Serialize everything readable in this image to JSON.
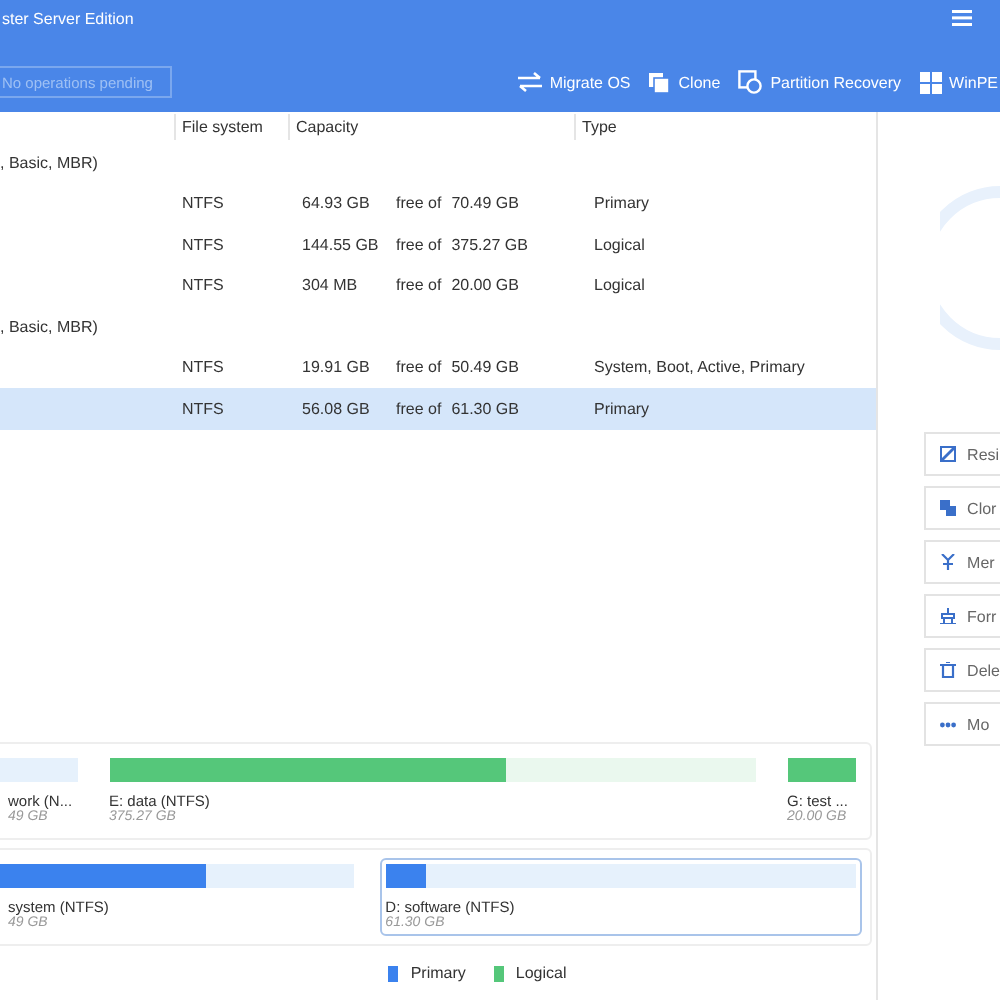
{
  "window": {
    "title": "ster Server Edition"
  },
  "toolbar": {
    "pending": "No operations pending",
    "buttons": [
      {
        "kind": "migrate",
        "label": "Migrate OS"
      },
      {
        "kind": "clone",
        "label": "Clone"
      },
      {
        "kind": "recovery",
        "label": "Partition Recovery"
      },
      {
        "kind": "winpe",
        "label": "WinPE"
      }
    ]
  },
  "table": {
    "columns": [
      "File system",
      "Capacity",
      "Type"
    ],
    "disks": [
      {
        "label": ", Basic, MBR)",
        "rows": [
          {
            "fs": "NTFS",
            "free": "64.93 GB",
            "of": "free of",
            "total": "70.49 GB",
            "type": "Primary",
            "selected": false
          },
          {
            "fs": "NTFS",
            "free": "144.55 GB",
            "of": "free of",
            "total": "375.27 GB",
            "type": "Logical",
            "selected": false
          },
          {
            "fs": "NTFS",
            "free": "304 MB",
            "of": "free of",
            "total": "20.00 GB",
            "type": "Logical",
            "selected": false
          }
        ]
      },
      {
        "label": ", Basic, MBR)",
        "rows": [
          {
            "fs": "NTFS",
            "free": "19.91 GB",
            "of": "free of",
            "total": "50.49 GB",
            "type": "System, Boot, Active, Primary",
            "selected": false
          },
          {
            "fs": "NTFS",
            "free": "56.08 GB",
            "of": "free of",
            "total": "61.30 GB",
            "type": "Primary",
            "selected": true
          }
        ]
      }
    ]
  },
  "actions": [
    {
      "kind": "resize",
      "label": "Resi"
    },
    {
      "kind": "clone",
      "label": "Clor"
    },
    {
      "kind": "merge",
      "label": "Mer"
    },
    {
      "kind": "format",
      "label": "Forr"
    },
    {
      "kind": "delete",
      "label": "Dele"
    },
    {
      "kind": "more",
      "label": "Mo"
    }
  ],
  "disk_map": [
    {
      "selected": false,
      "partitions": [
        {
          "name": "work (N...",
          "size": "49 GB",
          "kind": "primary",
          "selected": false
        },
        {
          "name": "E: data (NTFS)",
          "size": "375.27 GB",
          "kind": "logical",
          "level": 0.615,
          "selected": false
        },
        {
          "name": "G: test ...",
          "size": "20.00 GB",
          "kind": "logical",
          "level": 1,
          "selected": false
        }
      ]
    },
    {
      "selected": false,
      "partitions": [
        {
          "name": "system (NTFS)",
          "size": "49 GB",
          "kind": "primary",
          "level": 0.59,
          "selected": false
        },
        {
          "name": "D: software (NTFS)",
          "size": "61.30 GB",
          "kind": "primary",
          "level": 0.085,
          "selected": true
        }
      ]
    }
  ],
  "legend": [
    {
      "kind": "primary",
      "label": "Primary"
    },
    {
      "kind": "logical",
      "label": "Logical"
    }
  ]
}
